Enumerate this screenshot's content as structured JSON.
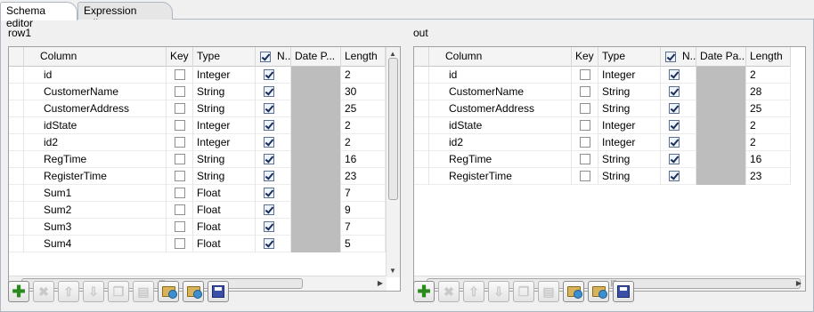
{
  "tabs": [
    {
      "label": "Schema editor",
      "active": true
    },
    {
      "label": "Expression editor",
      "active": false
    }
  ],
  "left": {
    "title": "row1",
    "columns": [
      "Column",
      "Key",
      "Type",
      "N..",
      "Date P...",
      "Length"
    ],
    "rows": [
      {
        "column": "id",
        "key": false,
        "type": "Integer",
        "nullable": true,
        "length": "2"
      },
      {
        "column": "CustomerName",
        "key": false,
        "type": "String",
        "nullable": true,
        "length": "30"
      },
      {
        "column": "CustomerAddress",
        "key": false,
        "type": "String",
        "nullable": true,
        "length": "25"
      },
      {
        "column": "idState",
        "key": false,
        "type": "Integer",
        "nullable": true,
        "length": "2"
      },
      {
        "column": "id2",
        "key": false,
        "type": "Integer",
        "nullable": true,
        "length": "2"
      },
      {
        "column": "RegTime",
        "key": false,
        "type": "String",
        "nullable": true,
        "length": "16"
      },
      {
        "column": "RegisterTime",
        "key": false,
        "type": "String",
        "nullable": true,
        "length": "23"
      },
      {
        "column": "Sum1",
        "key": false,
        "type": "Float",
        "nullable": true,
        "length": "7"
      },
      {
        "column": "Sum2",
        "key": false,
        "type": "Float",
        "nullable": true,
        "length": "9"
      },
      {
        "column": "Sum3",
        "key": false,
        "type": "Float",
        "nullable": true,
        "length": "7"
      },
      {
        "column": "Sum4",
        "key": false,
        "type": "Float",
        "nullable": true,
        "length": "5"
      }
    ],
    "header_nullable_checked": true
  },
  "right": {
    "title": "out",
    "columns": [
      "Column",
      "Key",
      "Type",
      "N..",
      "Date Pa...",
      "Length"
    ],
    "rows": [
      {
        "column": "id",
        "key": false,
        "type": "Integer",
        "nullable": true,
        "length": "2"
      },
      {
        "column": "CustomerName",
        "key": false,
        "type": "String",
        "nullable": true,
        "length": "28"
      },
      {
        "column": "CustomerAddress",
        "key": false,
        "type": "String",
        "nullable": true,
        "length": "25"
      },
      {
        "column": "idState",
        "key": false,
        "type": "Integer",
        "nullable": true,
        "length": "2"
      },
      {
        "column": "id2",
        "key": false,
        "type": "Integer",
        "nullable": true,
        "length": "2"
      },
      {
        "column": "RegTime",
        "key": false,
        "type": "String",
        "nullable": true,
        "length": "16"
      },
      {
        "column": "RegisterTime",
        "key": false,
        "type": "String",
        "nullable": true,
        "length": "23"
      }
    ],
    "header_nullable_checked": true
  },
  "hscroll_grip": "|||",
  "toolbar_icons": [
    "add-icon",
    "remove-icon",
    "move-up-icon",
    "move-down-icon",
    "copy-icon",
    "paste-icon",
    "import-icon",
    "export-icon",
    "save-icon"
  ],
  "colors": {
    "accent_add": "#2a8a1e",
    "save": "#3b4fa8",
    "date_cell": "#bdbdbd"
  }
}
